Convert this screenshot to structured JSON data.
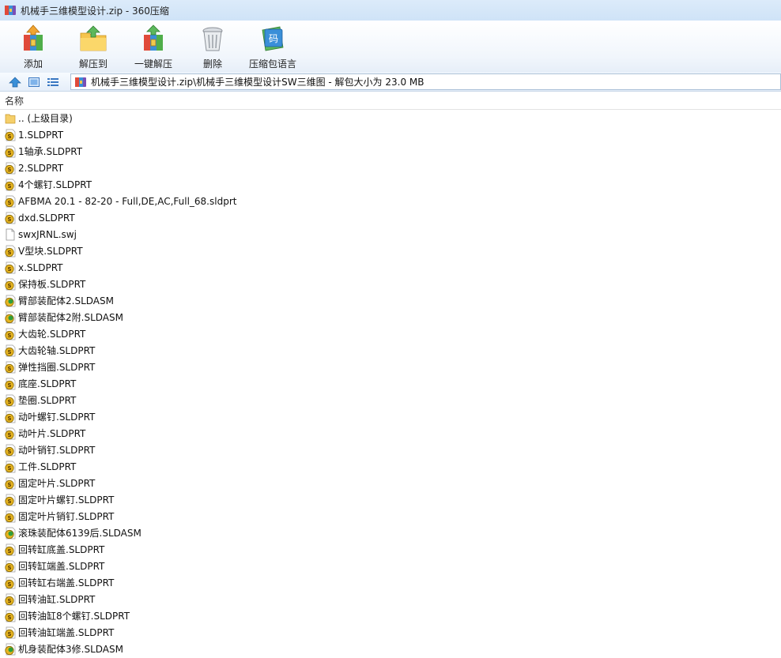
{
  "window": {
    "title": "机械手三维模型设计.zip - 360压缩"
  },
  "toolbar": {
    "buttons": [
      {
        "label": "添加",
        "icon": "add-archive-icon"
      },
      {
        "label": "解压到",
        "icon": "extract-to-icon"
      },
      {
        "label": "一键解压",
        "icon": "one-click-extract-icon"
      },
      {
        "label": "删除",
        "icon": "delete-icon"
      },
      {
        "label": "压缩包语言",
        "icon": "archive-language-icon"
      }
    ]
  },
  "colors": {
    "solidworks_part": "#e6b422",
    "solidworks_assembly": "#2e9e3a",
    "folder": "#f5cf6a"
  },
  "address": {
    "path": "机械手三维模型设计.zip\\机械手三维模型设计SW三维图 - 解包大小为 23.0 MB"
  },
  "list": {
    "column_name": "名称",
    "files": [
      {
        "name": ".. (上级目录)",
        "type": "parent"
      },
      {
        "name": "1.SLDPRT",
        "type": "part"
      },
      {
        "name": "1轴承.SLDPRT",
        "type": "part"
      },
      {
        "name": "2.SLDPRT",
        "type": "part"
      },
      {
        "name": "4个螺钉.SLDPRT",
        "type": "part"
      },
      {
        "name": "AFBMA 20.1 - 82-20 - Full,DE,AC,Full_68.sldprt",
        "type": "part"
      },
      {
        "name": "dxd.SLDPRT",
        "type": "part"
      },
      {
        "name": "swxJRNL.swj",
        "type": "generic"
      },
      {
        "name": "V型块.SLDPRT",
        "type": "part"
      },
      {
        "name": "x.SLDPRT",
        "type": "part"
      },
      {
        "name": "保持板.SLDPRT",
        "type": "part"
      },
      {
        "name": "臂部装配体2.SLDASM",
        "type": "assembly"
      },
      {
        "name": "臂部装配体2附.SLDASM",
        "type": "assembly"
      },
      {
        "name": "大齿轮.SLDPRT",
        "type": "part"
      },
      {
        "name": "大齿轮轴.SLDPRT",
        "type": "part"
      },
      {
        "name": "弹性挡圈.SLDPRT",
        "type": "part"
      },
      {
        "name": "底座.SLDPRT",
        "type": "part"
      },
      {
        "name": "垫圈.SLDPRT",
        "type": "part"
      },
      {
        "name": "动叶螺钉.SLDPRT",
        "type": "part"
      },
      {
        "name": "动叶片.SLDPRT",
        "type": "part"
      },
      {
        "name": "动叶销钉.SLDPRT",
        "type": "part"
      },
      {
        "name": "工件.SLDPRT",
        "type": "part"
      },
      {
        "name": "固定叶片.SLDPRT",
        "type": "part"
      },
      {
        "name": "固定叶片螺钉.SLDPRT",
        "type": "part"
      },
      {
        "name": "固定叶片销钉.SLDPRT",
        "type": "part"
      },
      {
        "name": "滚珠装配体6139后.SLDASM",
        "type": "assembly"
      },
      {
        "name": "回转缸底盖.SLDPRT",
        "type": "part"
      },
      {
        "name": "回转缸端盖.SLDPRT",
        "type": "part"
      },
      {
        "name": "回转缸右端盖.SLDPRT",
        "type": "part"
      },
      {
        "name": "回转油缸.SLDPRT",
        "type": "part"
      },
      {
        "name": "回转油缸8个螺钉.SLDPRT",
        "type": "part"
      },
      {
        "name": "回转油缸端盖.SLDPRT",
        "type": "part"
      },
      {
        "name": "机身装配体3修.SLDASM",
        "type": "assembly"
      }
    ]
  }
}
